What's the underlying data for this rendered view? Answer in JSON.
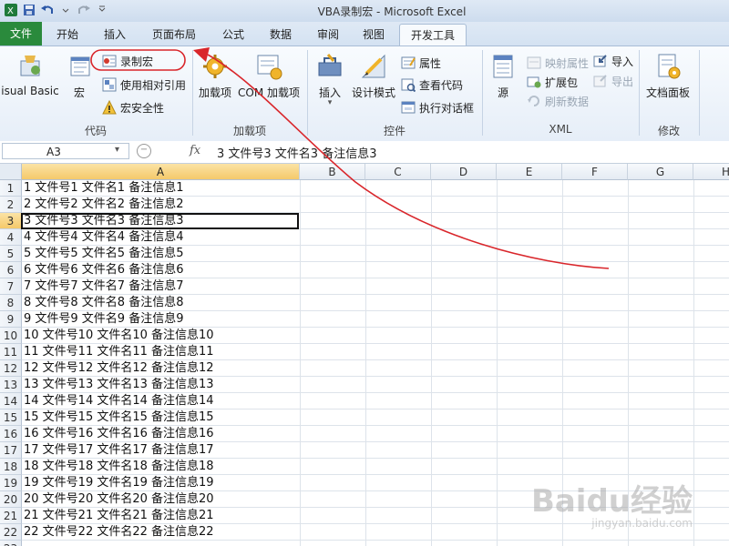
{
  "window": {
    "title": "VBA录制宏  -  Microsoft Excel"
  },
  "tabs": [
    {
      "label": "文件"
    },
    {
      "label": "开始"
    },
    {
      "label": "插入"
    },
    {
      "label": "页面布局"
    },
    {
      "label": "公式"
    },
    {
      "label": "数据"
    },
    {
      "label": "审阅"
    },
    {
      "label": "视图"
    },
    {
      "label": "开发工具"
    }
  ],
  "ribbon": {
    "code": {
      "label": "代码",
      "visual_basic": "isual Basic",
      "macro": "宏",
      "record_macro": "录制宏",
      "relative_ref": "使用相对引用",
      "macro_security": "宏安全性"
    },
    "addins": {
      "label": "加载项",
      "addins": "加载项",
      "com_addins": "COM 加载项"
    },
    "controls": {
      "label": "控件",
      "insert": "插入",
      "design_mode": "设计模式",
      "properties": "属性",
      "view_code": "查看代码",
      "run_dialog": "执行对话框"
    },
    "xml": {
      "label": "XML",
      "source": "源",
      "map_props": "映射属性",
      "expansion": "扩展包",
      "refresh": "刷新数据",
      "import": "导入",
      "export": "导出"
    },
    "modify": {
      "label": "修改",
      "doc_panel": "文档面板"
    }
  },
  "formula_bar": {
    "name_box": "A3",
    "fx": "fx",
    "value": "3  文件号3  文件名3  备注信息3"
  },
  "columns": [
    "A",
    "B",
    "C",
    "D",
    "E",
    "F",
    "G",
    "H"
  ],
  "rows": [
    {
      "n": "1",
      "a": "1  文件号1  文件名1  备注信息1"
    },
    {
      "n": "2",
      "a": "2  文件号2  文件名2  备注信息2"
    },
    {
      "n": "3",
      "a": "3  文件号3  文件名3  备注信息3"
    },
    {
      "n": "4",
      "a": "4  文件号4  文件名4  备注信息4"
    },
    {
      "n": "5",
      "a": "5  文件号5  文件名5  备注信息5"
    },
    {
      "n": "6",
      "a": "6  文件号6  文件名6  备注信息6"
    },
    {
      "n": "7",
      "a": "7  文件号7  文件名7  备注信息7"
    },
    {
      "n": "8",
      "a": "8  文件号8  文件名8  备注信息8"
    },
    {
      "n": "9",
      "a": "9  文件号9  文件名9  备注信息9"
    },
    {
      "n": "10",
      "a": "10  文件号10  文件名10  备注信息10"
    },
    {
      "n": "11",
      "a": "11  文件号11  文件名11  备注信息11"
    },
    {
      "n": "12",
      "a": "12  文件号12  文件名12  备注信息12"
    },
    {
      "n": "13",
      "a": "13  文件号13  文件名13  备注信息13"
    },
    {
      "n": "14",
      "a": "14  文件号14  文件名14  备注信息14"
    },
    {
      "n": "15",
      "a": "15  文件号15  文件名15  备注信息15"
    },
    {
      "n": "16",
      "a": "16  文件号16  文件名16  备注信息16"
    },
    {
      "n": "17",
      "a": "17  文件号17  文件名17  备注信息17"
    },
    {
      "n": "18",
      "a": "18  文件号18  文件名18  备注信息18"
    },
    {
      "n": "19",
      "a": "19  文件号19  文件名19  备注信息19"
    },
    {
      "n": "20",
      "a": "20  文件号20  文件名20  备注信息20"
    },
    {
      "n": "21",
      "a": "21  文件号21  文件名21  备注信息21"
    },
    {
      "n": "22",
      "a": "22  文件号22  文件名22  备注信息22"
    },
    {
      "n": "23",
      "a": ""
    }
  ],
  "selected": {
    "row": "3",
    "col": "A"
  },
  "watermark": {
    "brand": "Baidu经验",
    "url": "jingyan.baidu.com"
  },
  "colors": {
    "file_tab": "#2a8a3c",
    "annotation": "#d9262b",
    "selection": "#f5c96a"
  }
}
